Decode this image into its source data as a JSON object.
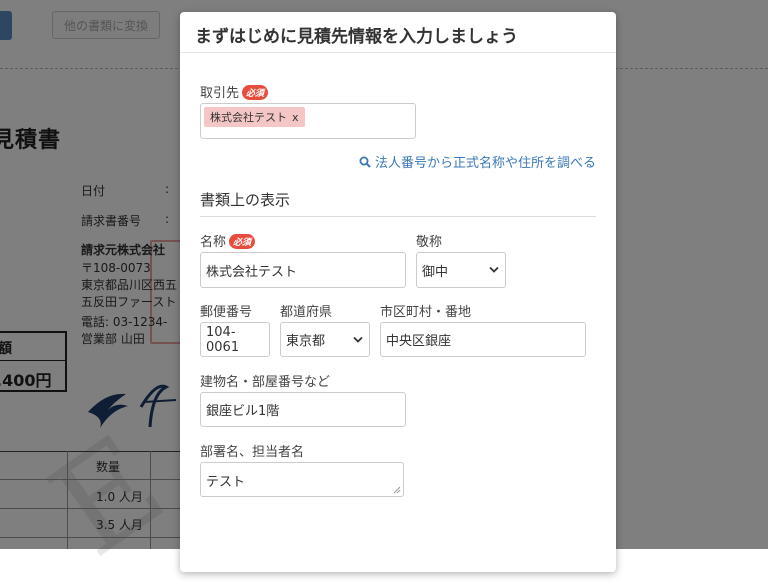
{
  "background": {
    "convert_button": "他の書類に変換",
    "doc_title": "見積書",
    "date_label": "日付",
    "invoice_no_label": "請求書番号",
    "colon": ":",
    "issuer_lines": [
      "請求元株式会社",
      "〒108-0073",
      "東京都品川区西五",
      "五反田ファースト",
      "電話: 03-1234-",
      "営業部 山田"
    ],
    "amount_label": "額",
    "amount_value": ",400円",
    "table_header_qty": "数量",
    "rows": [
      "1.0 人月",
      "3.5 人月"
    ]
  },
  "modal": {
    "title": "まずはじめに見積先情報を入力しましょう",
    "client_label": "取引先",
    "required_badge": "必須",
    "client_tag": "株式会社テスト",
    "client_tag_remove": "x",
    "lookup_link": "法人番号から正式名称や住所を調べる",
    "section_title": "書類上の表示",
    "name_label": "名称",
    "name_value": "株式会社テスト",
    "honorific_label": "敬称",
    "honorific_value": "御中",
    "postal_label": "郵便番号",
    "postal_value": "104-0061",
    "prefecture_label": "都道府県",
    "prefecture_value": "東京都",
    "city_label": "市区町村・番地",
    "city_value": "中央区銀座",
    "building_label": "建物名・部屋番号など",
    "building_value": "銀座ビル1階",
    "department_label": "部署名、担当者名",
    "department_value": "テスト"
  },
  "colors": {
    "overlay": "rgba(0,0,0,0.5)",
    "required_badge": "#e74c3c",
    "tag_bg": "#f5c6c6",
    "link": "#3a78b8"
  },
  "icons": [
    "search-icon",
    "chevron-down-icon",
    "resize-handle-icon"
  ]
}
